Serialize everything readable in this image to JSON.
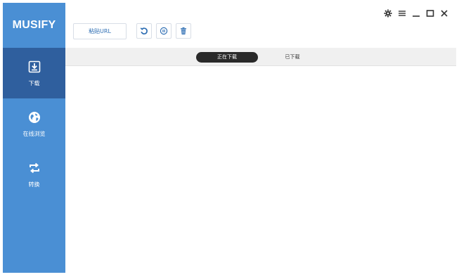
{
  "app": {
    "logo": "MUSIFY"
  },
  "colors": {
    "sidebar": "#4a8fd4",
    "sidebar_active": "#2f5f9e",
    "accent": "#4a8fd4",
    "tab_active_bg": "#2a2a2a"
  },
  "sidebar": {
    "items": [
      {
        "label": "下载",
        "icon": "download-icon",
        "active": true
      },
      {
        "label": "在线浏览",
        "icon": "globe-icon",
        "active": false
      },
      {
        "label": "转换",
        "icon": "convert-icon",
        "active": false
      }
    ]
  },
  "toolbar": {
    "paste_label": "粘贴URL",
    "icons": [
      "refresh-icon",
      "pause-icon",
      "trash-icon"
    ]
  },
  "window_controls": {
    "icons": [
      "gear-icon",
      "menu-icon",
      "minimize-icon",
      "maximize-icon",
      "close-icon"
    ]
  },
  "tabs": [
    {
      "label": "正在下载",
      "active": true
    },
    {
      "label": "已下载",
      "active": false
    }
  ]
}
